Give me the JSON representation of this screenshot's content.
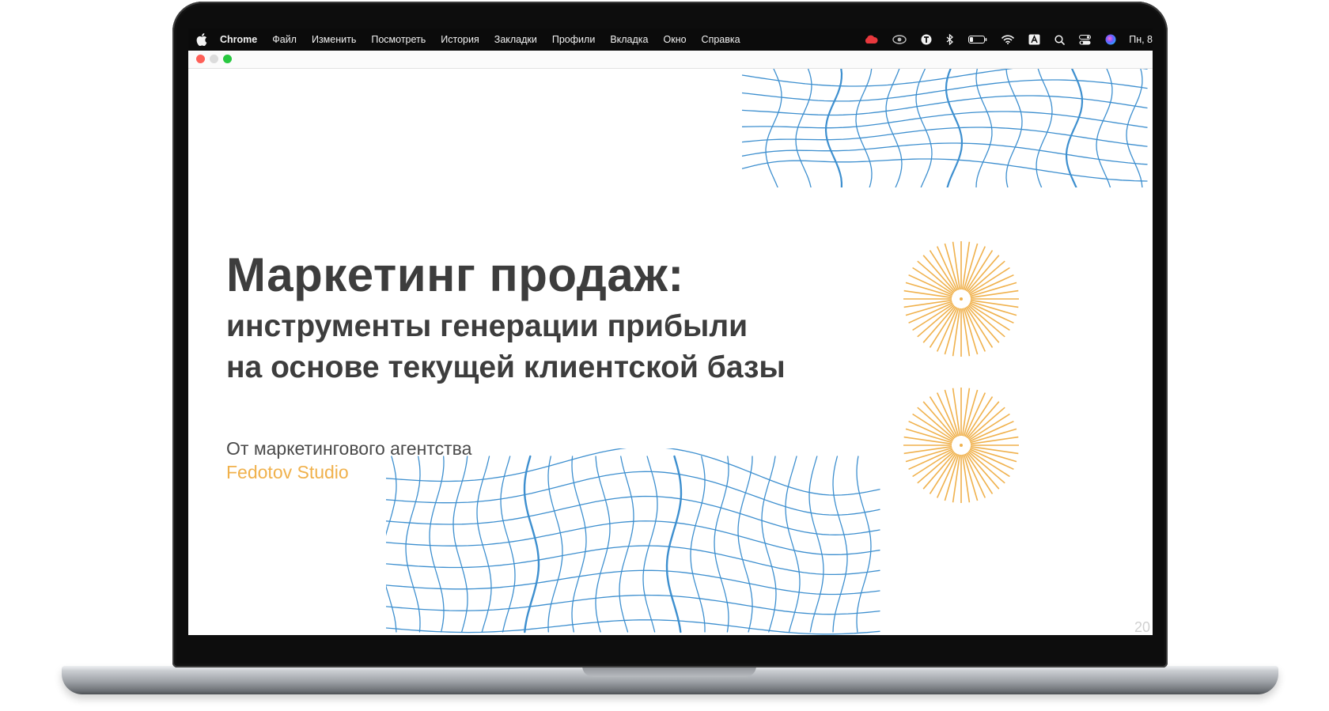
{
  "menubar": {
    "app_name": "Chrome",
    "items": [
      "Файл",
      "Изменить",
      "Посмотреть",
      "История",
      "Закладки",
      "Профили",
      "Вкладка",
      "Окно",
      "Справка"
    ],
    "clock": "Пн, 8",
    "status_icons": [
      "creative-cloud-icon",
      "eye-icon",
      "t-app-icon",
      "bluetooth-icon",
      "battery-icon",
      "wifi-icon",
      "input-source-icon",
      "spotlight-search-icon",
      "control-center-icon",
      "siri-icon"
    ],
    "input_source_letter": "A"
  },
  "slide": {
    "title": "Маркетинг продаж:",
    "subtitle_line1": "инструменты генерации прибыли",
    "subtitle_line2": "на основе текущей клиентской базы",
    "byline": "От маркетингового агентства",
    "studio": "Fedotov Studio",
    "page_number": "20"
  },
  "colors": {
    "grid_blue": "#3d8fcf",
    "accent_orange": "#f0b14c",
    "title_text": "#3d3d3d"
  }
}
